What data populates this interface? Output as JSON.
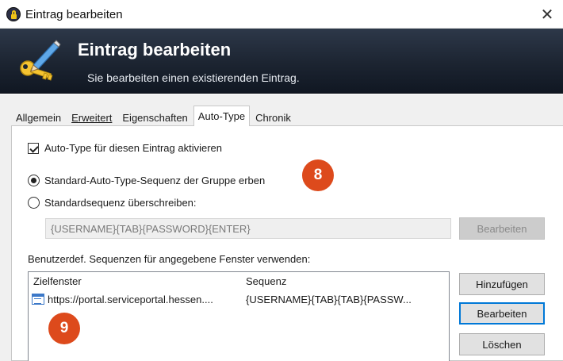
{
  "window": {
    "title": "Eintrag bearbeiten",
    "close_glyph": "✕"
  },
  "banner": {
    "title": "Eintrag bearbeiten",
    "subtitle": "Sie bearbeiten einen existierenden Eintrag."
  },
  "tabs": [
    {
      "label": "Allgemein",
      "active": false
    },
    {
      "label": "Erweitert",
      "active": false
    },
    {
      "label": "Eigenschaften",
      "active": false
    },
    {
      "label": "Auto-Type",
      "active": true
    },
    {
      "label": "Chronik",
      "active": false
    }
  ],
  "autotype": {
    "enable_label": "Auto-Type für diesen Eintrag aktivieren",
    "enable_checked": true,
    "inherit_label": "Standard-Auto-Type-Sequenz der Gruppe erben",
    "inherit_selected": true,
    "override_label": "Standardsequenz überschreiben:",
    "override_selected": false,
    "sequence_value": "{USERNAME}{TAB}{PASSWORD}{ENTER}",
    "edit_sequence_button": "Bearbeiten",
    "custom_section_label": "Benutzerdef. Sequenzen für angegebene Fenster verwenden:",
    "list_columns": [
      "Zielfenster",
      "Sequenz"
    ],
    "list_rows": [
      {
        "window": "https://portal.serviceportal.hessen....",
        "sequence": "{USERNAME}{TAB}{TAB}{PASSW..."
      }
    ],
    "add_button": "Hinzufügen",
    "edit_button": "Bearbeiten",
    "delete_button": "Löschen"
  },
  "callouts": {
    "badge_8": "8",
    "badge_9": "9",
    "color": "#dd4a1c"
  }
}
